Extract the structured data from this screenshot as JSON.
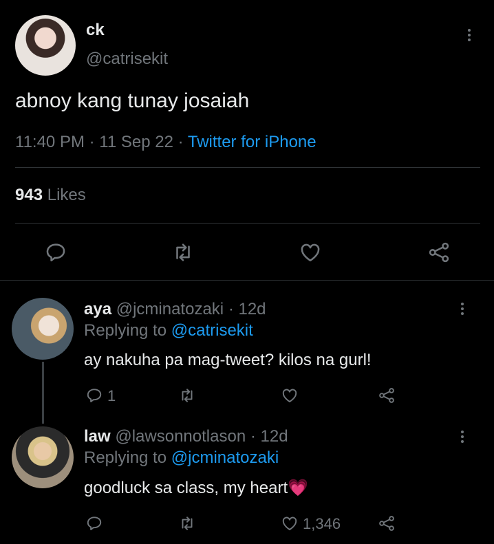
{
  "main_tweet": {
    "name": "ck",
    "handle": "@catrisekit",
    "text": "abnoy kang tunay josaiah",
    "time": "11:40 PM",
    "date": "11 Sep 22",
    "separator": "·",
    "source": "Twitter for iPhone",
    "likes_count": "943",
    "likes_label": "Likes"
  },
  "replies": [
    {
      "name": "aya",
      "handle": "@jcminatozaki",
      "age": "· 12d",
      "replying_prefix": "Replying to",
      "replying_to": "@catrisekit",
      "text": "ay nakuha pa mag-tweet? kilos na gurl!",
      "reply_count": "1",
      "like_count": ""
    },
    {
      "name": "law",
      "handle": "@lawsonnotlason",
      "age": "· 12d",
      "replying_prefix": "Replying to",
      "replying_to": "@jcminatozaki",
      "text": "goodluck sa class, my heart💗",
      "reply_count": "",
      "like_count": "1,346"
    }
  ],
  "icons": {
    "reply": "reply-icon",
    "retweet": "retweet-icon",
    "like": "heart-icon",
    "share": "share-icon",
    "more": "more-vertical-icon"
  },
  "colors": {
    "background": "#000000",
    "text": "#e7e9ea",
    "muted": "#71767b",
    "link": "#1d9bf0",
    "divider": "#2f3336"
  }
}
